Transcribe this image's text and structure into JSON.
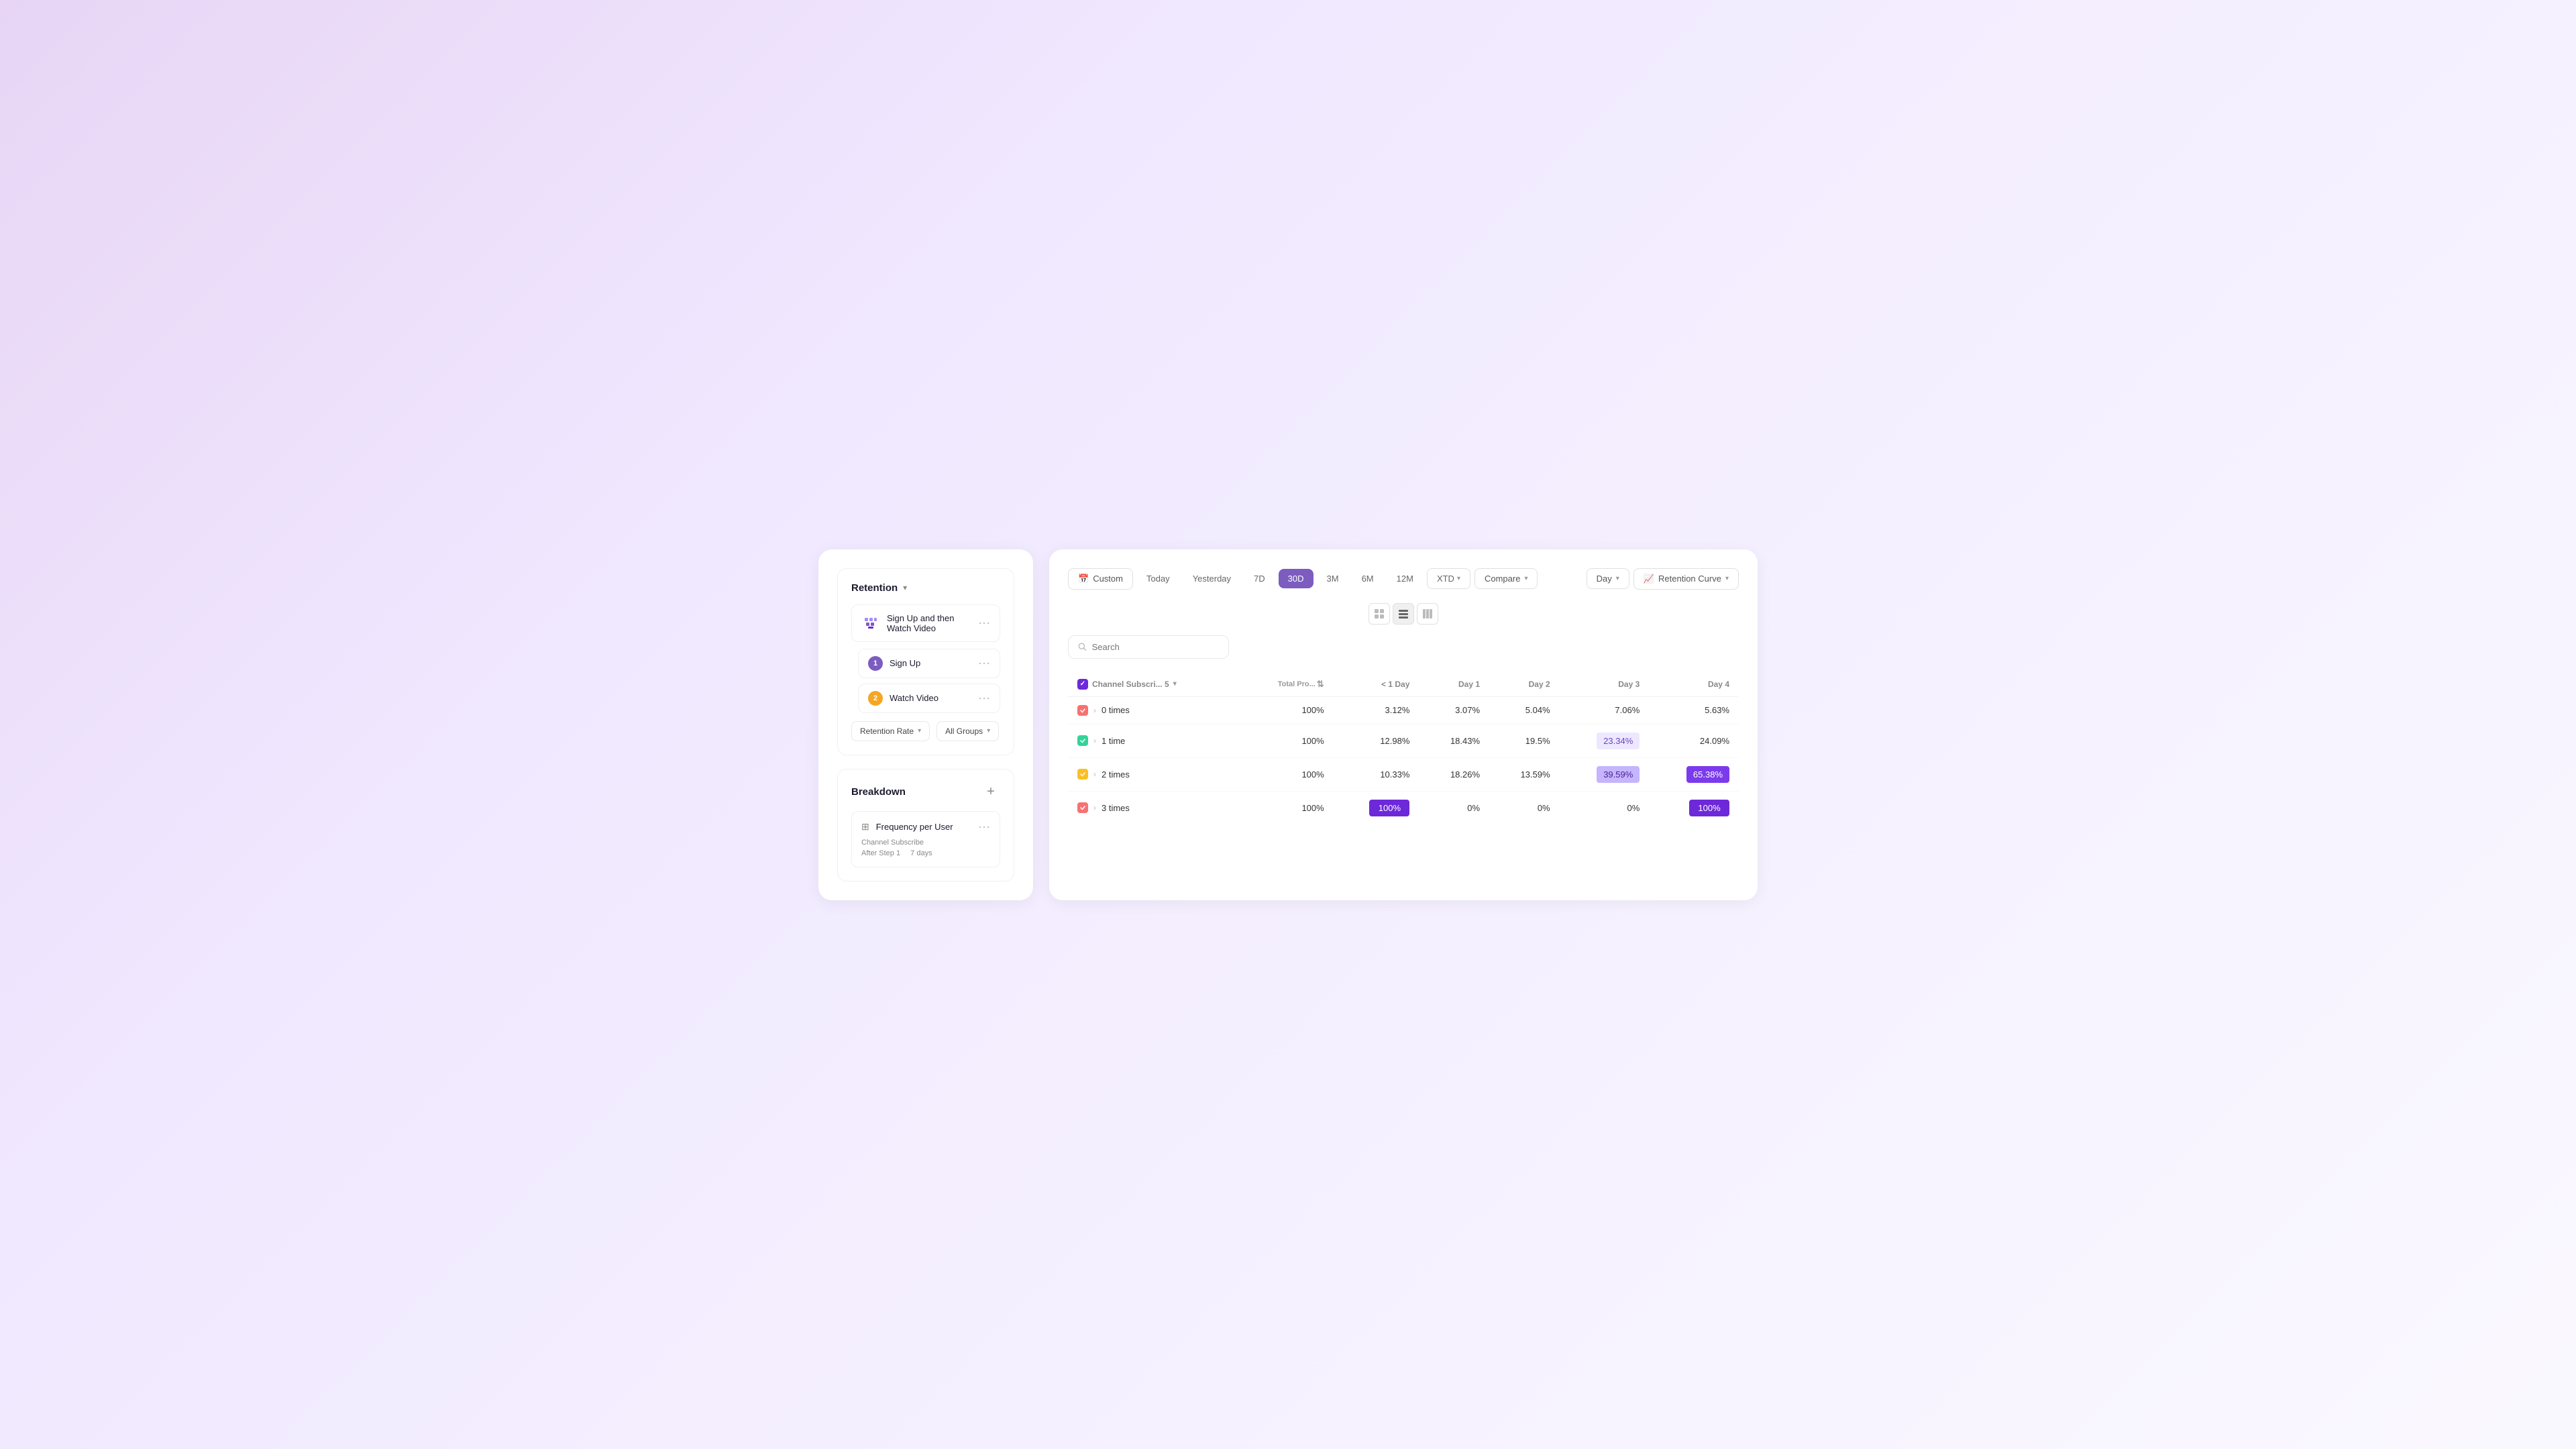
{
  "left_panel": {
    "retention_card": {
      "title": "Retention",
      "funnel_label": "Sign Up and then Watch Video",
      "steps": [
        {
          "number": "1",
          "label": "Sign Up",
          "color": "step-1"
        },
        {
          "number": "2",
          "label": "Watch Video",
          "color": "step-2"
        }
      ],
      "filter_retention_rate": "Retention Rate",
      "filter_all_groups": "All Groups"
    },
    "breakdown_card": {
      "title": "Breakdown",
      "item_title": "Frequency per User",
      "meta_channel": "Channel Subscribe",
      "meta_after": "After Step 1",
      "meta_days": "7 days"
    }
  },
  "right_panel": {
    "time_filters": [
      "Custom",
      "Today",
      "Yesterday",
      "7D",
      "30D",
      "6M",
      "12M",
      "XTD"
    ],
    "active_filter": "30D",
    "compare_label": "Compare",
    "day_label": "Day",
    "curve_label": "Retention Curve",
    "search_placeholder": "Search",
    "view_icons": [
      "grid-sm",
      "grid-md",
      "grid-lg"
    ],
    "table": {
      "headers": [
        "Channel Subscri... 5",
        "Total Pro...",
        "< 1 Day",
        "Day 1",
        "Day 2",
        "Day 3",
        "Day 4"
      ],
      "rows": [
        {
          "color": "#f87171",
          "label": "0 times",
          "total": "100%",
          "day0": "3.12%",
          "day1": "3.07%",
          "day2": "5.04%",
          "day3": "7.06%",
          "day4": "5.63%",
          "highlights": [
            false,
            false,
            false,
            false,
            false
          ]
        },
        {
          "color": "#34d399",
          "label": "1 time",
          "total": "100%",
          "day0": "12.98%",
          "day1": "18.43%",
          "day2": "19.5%",
          "day3": "23.34%",
          "day4": "24.09%",
          "highlights": [
            false,
            false,
            false,
            true,
            false
          ]
        },
        {
          "color": "#fbbf24",
          "label": "2 times",
          "total": "100%",
          "day0": "10.33%",
          "day1": "18.26%",
          "day2": "13.59%",
          "day3": "39.59%",
          "day4": "65.38%",
          "highlights": [
            false,
            false,
            false,
            true,
            true
          ]
        },
        {
          "color": "#f87171",
          "label": "3 times",
          "total": "100%",
          "day0": "100%",
          "day1": "0%",
          "day2": "0%",
          "day3": "0%",
          "day4": "100%",
          "highlights": [
            true,
            false,
            false,
            false,
            true
          ]
        }
      ]
    }
  }
}
